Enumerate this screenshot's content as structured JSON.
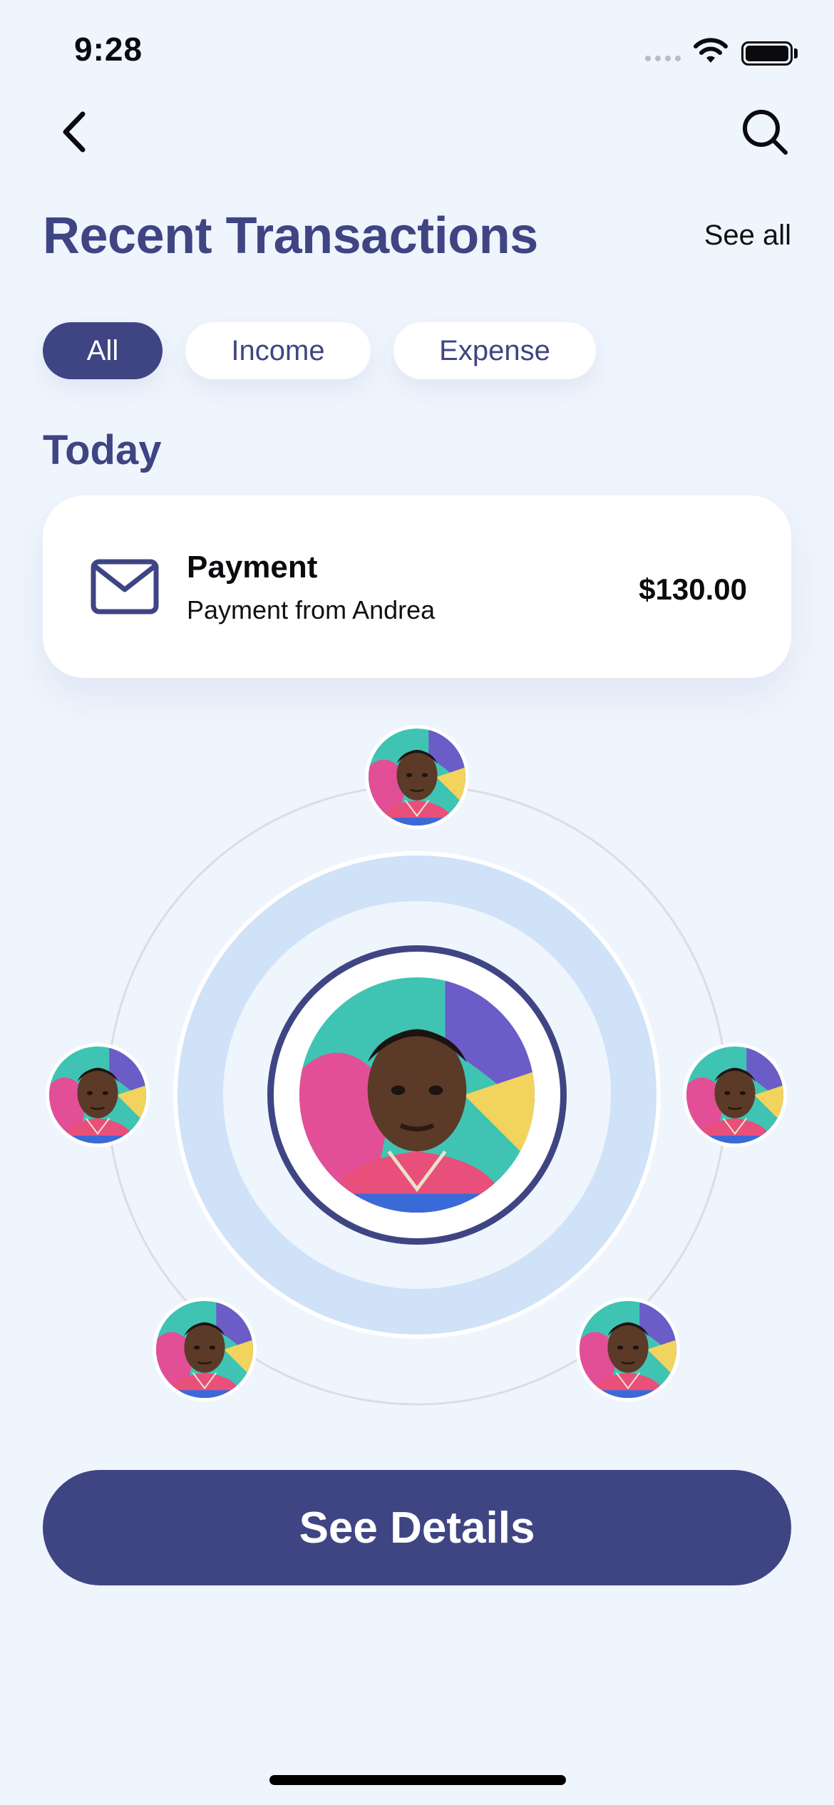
{
  "status_bar": {
    "time": "9:28"
  },
  "header": {
    "title": "Recent Transactions",
    "see_all": "See all"
  },
  "filters": [
    {
      "label": "All",
      "active": true
    },
    {
      "label": "Income",
      "active": false
    },
    {
      "label": "Expense",
      "active": false
    }
  ],
  "section": {
    "title": "Today"
  },
  "transaction": {
    "icon": "mail-icon",
    "title": "Payment",
    "subtitle": "Payment from Andrea",
    "amount": "$130.00"
  },
  "cta": {
    "label": "See Details"
  },
  "colors": {
    "accent": "#3f4583",
    "background": "#eff5fd",
    "ring": "#cfe2f8"
  }
}
